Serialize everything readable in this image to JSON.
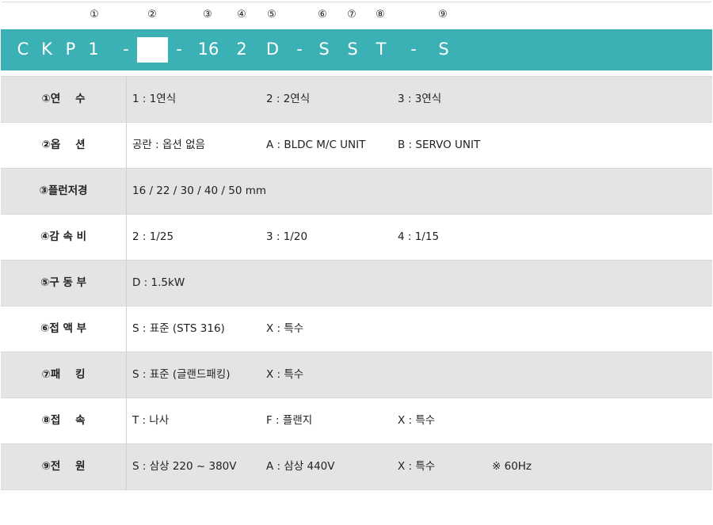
{
  "positions": [
    "①",
    "②",
    "③",
    "④",
    "⑤",
    "⑥",
    "⑦",
    "⑧",
    "⑨"
  ],
  "code": {
    "chars_before": [
      "C",
      "K",
      "P",
      "1",
      "-"
    ],
    "chars_after": [
      "-",
      "16",
      "2",
      "D",
      "-",
      "S",
      "S",
      "T",
      "-",
      "S"
    ]
  },
  "rows": [
    {
      "label": "①연    수",
      "cells": [
        "1 : 1연식",
        "2 : 2연식",
        "3 : 3연식",
        ""
      ]
    },
    {
      "label": "②옵    션",
      "cells": [
        "공란 : 옵션 없음",
        "A : BLDC M/C UNIT",
        "B : SERVO UNIT",
        ""
      ]
    },
    {
      "label": "③플런저경",
      "cells": [
        "16 / 22 / 30 / 40 / 50 mm",
        "",
        "",
        ""
      ]
    },
    {
      "label": "④감 속 비",
      "cells": [
        "2 : 1/25",
        "3 : 1/20",
        "4 : 1/15",
        ""
      ]
    },
    {
      "label": "⑤구 동 부",
      "cells": [
        "D : 1.5kW",
        "",
        "",
        ""
      ]
    },
    {
      "label": "⑥접 액 부",
      "cells": [
        "S : 표준 (STS 316)",
        "X : 특수",
        "",
        ""
      ]
    },
    {
      "label": "⑦패    킹",
      "cells": [
        "S : 표준 (글랜드패킹)",
        "X : 특수",
        "",
        ""
      ]
    },
    {
      "label": "⑧접    속",
      "cells": [
        "T : 나사",
        "F : 플랜지",
        "X : 특수",
        ""
      ]
    },
    {
      "label": "⑨전    원",
      "cells": [
        "S : 삼상 220 ~ 380V",
        "A : 삼상 440V",
        "X : 특수",
        "※ 60Hz"
      ]
    }
  ],
  "colors": {
    "accent": "#3cb1b5",
    "shaded_row": "#e4e4e4"
  }
}
